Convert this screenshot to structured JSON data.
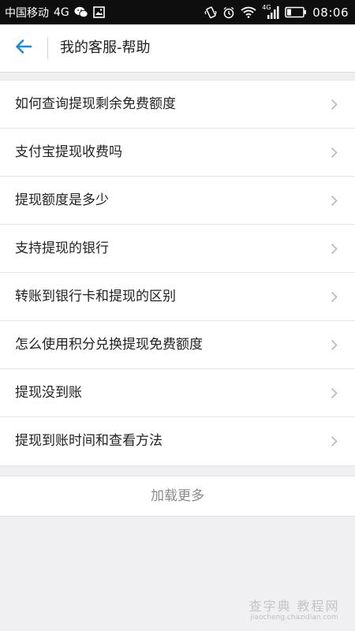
{
  "status_bar": {
    "carrier": "中国移动",
    "network": "4G",
    "network_small": "4G",
    "time": "08:06",
    "icons": [
      "wechat-icon",
      "image-icon",
      "vibrate-icon",
      "alarm-icon",
      "wifi-icon",
      "signal-icon",
      "battery-icon"
    ]
  },
  "header": {
    "back_icon": "arrow-left-icon",
    "title": "我的客服-帮助",
    "accent_color": "#1a8ad9"
  },
  "help_list": {
    "items": [
      {
        "label": "如何查询提现剩余免费额度"
      },
      {
        "label": "支付宝提现收费吗"
      },
      {
        "label": "提现额度是多少"
      },
      {
        "label": "支持提现的银行"
      },
      {
        "label": "转账到银行卡和提现的区别"
      },
      {
        "label": "怎么使用积分兑换提现免费额度"
      },
      {
        "label": "提现没到账"
      },
      {
        "label": "提现到账时间和查看方法"
      }
    ],
    "chevron_icon": "chevron-right-icon"
  },
  "load_more": {
    "label": "加载更多"
  },
  "watermark": {
    "title": "查字典 教程网",
    "url": "jiaocheng.chazidian.com"
  }
}
